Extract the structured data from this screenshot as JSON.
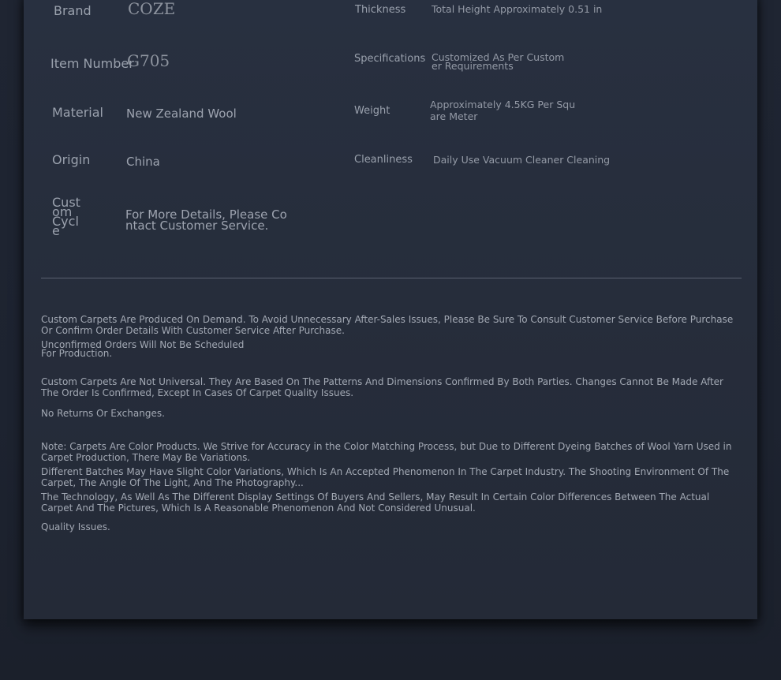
{
  "specs": {
    "brand_label": "Brand",
    "brand_value": "COZE",
    "item_number_label": "Item Number",
    "item_number_value": "G705",
    "material_label": "Material",
    "material_value": "New Zealand Wool",
    "origin_label": "Origin",
    "origin_value": "China",
    "custom_cycle_label_1": "Cust",
    "custom_cycle_label_2": "om",
    "custom_cycle_label_3": "Cycl",
    "custom_cycle_label_4": "e",
    "custom_cycle_value_1": "For More Details, Please Co",
    "custom_cycle_value_2": "ntact Customer Service.",
    "thickness_label": "Thickness",
    "thickness_value": "Total Height Approximately 0.51 in",
    "specifications_label": "Specifications",
    "specifications_value_1": "Customized As Per Custom",
    "specifications_value_2": "er Requirements",
    "weight_label": "Weight",
    "weight_value_1": "Approximately 4.5KG Per Squ",
    "weight_value_2": "are Meter",
    "cleanliness_label": "Cleanliness",
    "cleanliness_value": "Daily Use Vacuum Cleaner Cleaning"
  },
  "notes": {
    "p1": "Custom Carpets Are Produced On Demand. To Avoid Unnecessary After-Sales Issues, Please Be Sure To Consult Customer Service Before Purchase Or Confirm Order Details With Customer Service After Purchase.",
    "p2_line1": "Unconfirmed Orders Will Not Be Scheduled",
    "p2_line2": "For Production.",
    "p3": "Custom Carpets Are Not Universal. They Are Based On The Patterns And Dimensions Confirmed By Both Parties. Changes Cannot Be Made After The Order Is Confirmed, Except In Cases Of Carpet Quality Issues.",
    "p4": "No Returns Or Exchanges.",
    "p5": "Note: Carpets Are Color Products. We Strive for Accuracy in the Color Matching Process, but Due to Different Dyeing Batches of Wool Yarn Used in Carpet Production, There May Be Variations.",
    "p6": "Different Batches May Have Slight Color Variations, Which Is An Accepted Phenomenon In The Carpet Industry. The Shooting Environment Of The Carpet, The Angle Of The Light, And The Photography...",
    "p7": "The Technology, As Well As The Different Display Settings Of Buyers And Sellers, May Result In Certain Color Differences Between The Actual Carpet And The Pictures, Which Is A Reasonable Phenomenon And Not Considered Unusual.",
    "p8": "Quality Issues."
  }
}
